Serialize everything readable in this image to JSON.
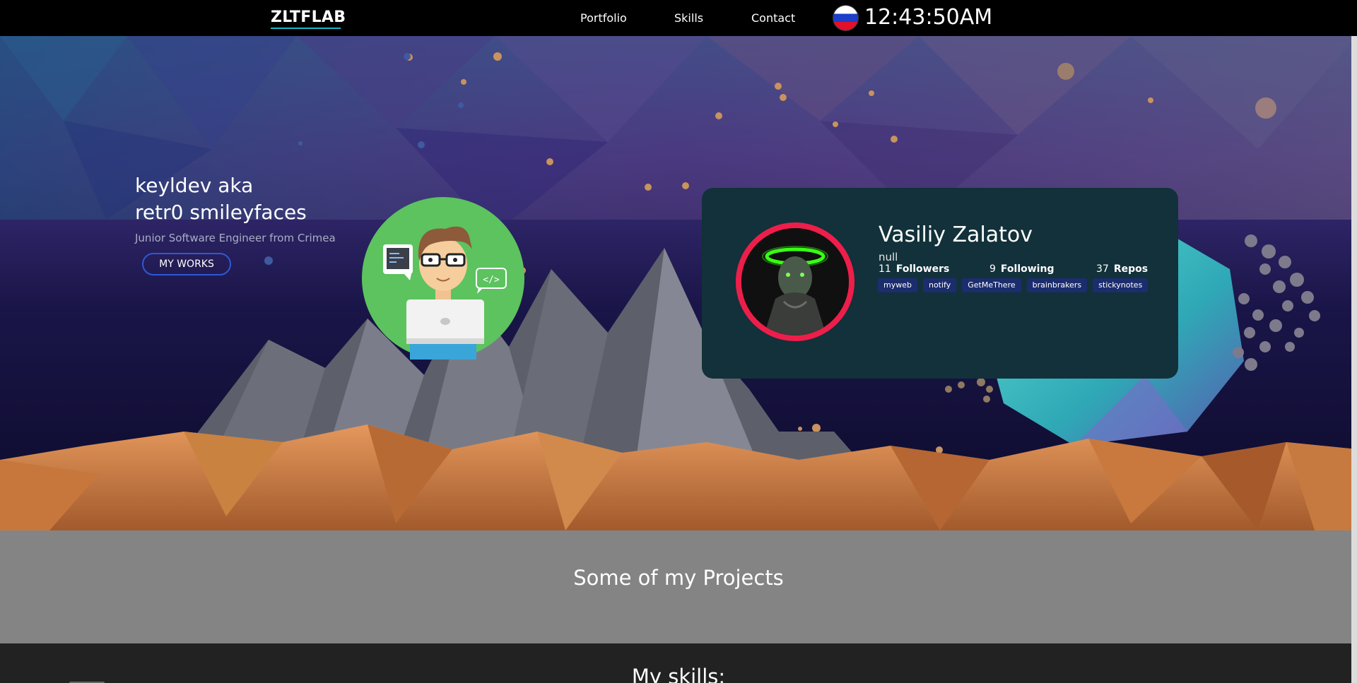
{
  "nav": {
    "logo": "ZLTFLAB",
    "links": [
      "Portfolio",
      "Skills",
      "Contact"
    ],
    "clock": "12:43:50AM",
    "flag_colors": [
      "#ffffff",
      "#1c3ec9",
      "#e1102b"
    ]
  },
  "hero": {
    "title_line1": "keyldev aka",
    "title_line2": "retr0 smileyfaces",
    "subtitle": "Junior Software Engineer from Crimea",
    "button": "MY WORKS",
    "illustration_code_label": "</>"
  },
  "profile": {
    "name": "Vasiliy Zalatov",
    "bio": "null",
    "followers": {
      "count": "11",
      "label": "Followers"
    },
    "following": {
      "count": "9",
      "label": "Following"
    },
    "repos_stat": {
      "count": "37",
      "label": "Repos"
    },
    "repos": [
      "myweb",
      "notify",
      "GetMeThere",
      "brainbrakers",
      "stickynotes"
    ],
    "avatar_ring_color": "#ee1e4b",
    "card_color": "#12313a"
  },
  "projects": {
    "title": "Some of my Projects"
  },
  "skills": {
    "title": "My skills:"
  },
  "colors": {
    "accent": "#1eb7c9",
    "button_border": "#2f58d6",
    "tag_bg": "#1c2d6e"
  }
}
